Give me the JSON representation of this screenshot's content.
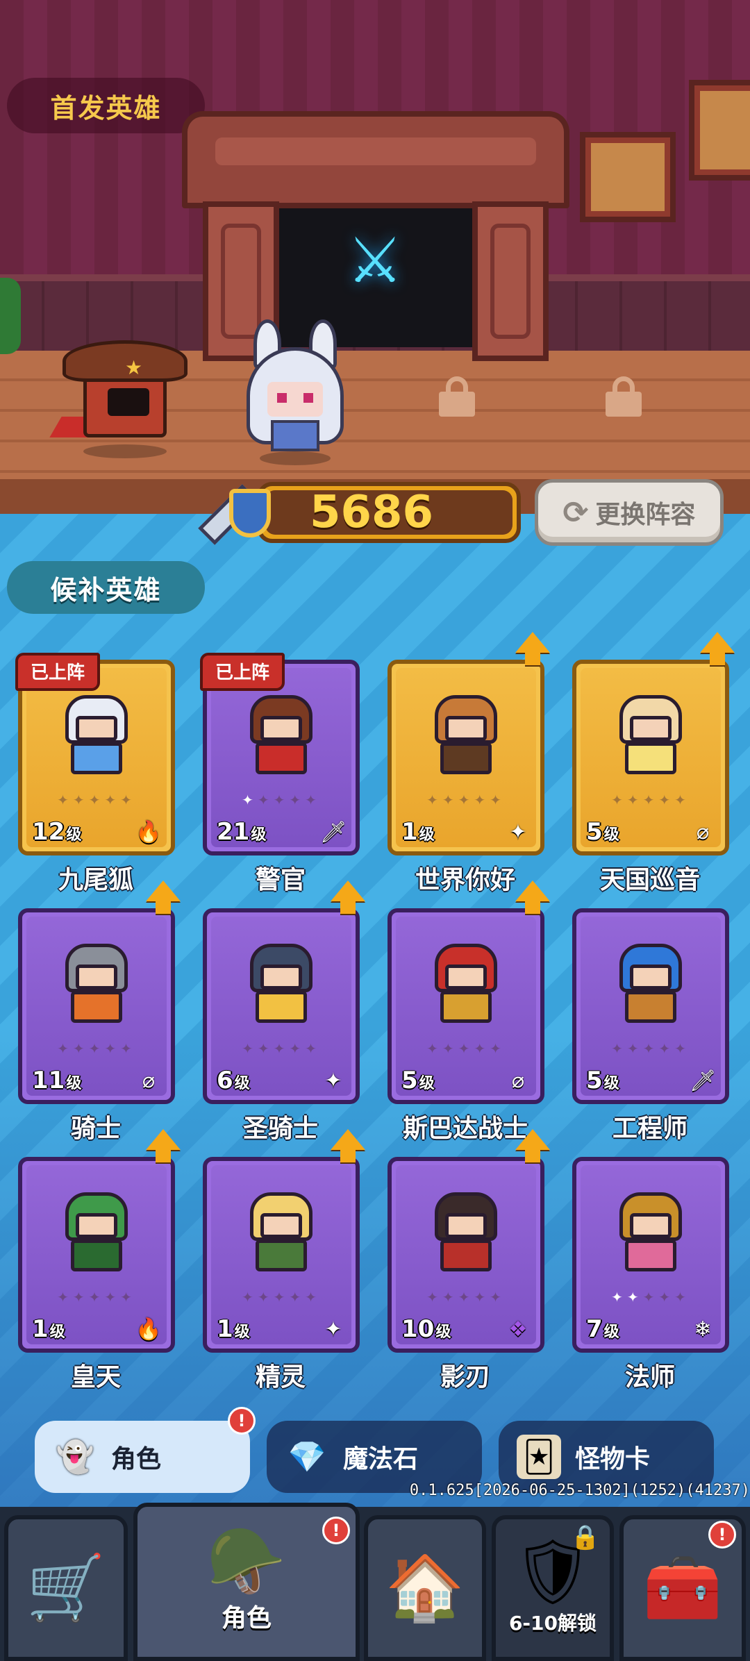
{
  "scene": {
    "starter_label": "首发英雄",
    "power_value": "5686",
    "swap_button_label": "更换阵容",
    "swap_icon": "refresh-icon",
    "battle_icon": "crossed-swords-icon",
    "locked_slots": 2
  },
  "bench": {
    "title": "候补英雄",
    "deployed_badge": "已上阵",
    "level_unit": "级",
    "heroes": [
      {
        "name": "九尾狐",
        "level": "12",
        "rarity": "gold",
        "element": "fire",
        "element_icon": "🔥",
        "deployed": true,
        "upgradable": false,
        "stars_lit": 0
      },
      {
        "name": "警官",
        "level": "21",
        "rarity": "purple",
        "element": "sword",
        "element_icon": "🗡",
        "deployed": true,
        "upgradable": false,
        "stars_lit": 1
      },
      {
        "name": "世界你好",
        "level": "1",
        "rarity": "gold",
        "element": "sparkle",
        "element_icon": "✦",
        "deployed": false,
        "upgradable": true,
        "stars_lit": 0
      },
      {
        "name": "天国巡音",
        "level": "5",
        "rarity": "gold",
        "element": "void",
        "element_icon": "⌀",
        "deployed": false,
        "upgradable": true,
        "stars_lit": 0
      },
      {
        "name": "骑士",
        "level": "11",
        "rarity": "purple",
        "element": "void",
        "element_icon": "⌀",
        "deployed": false,
        "upgradable": true,
        "stars_lit": 0
      },
      {
        "name": "圣骑士",
        "level": "6",
        "rarity": "purple",
        "element": "sparkle",
        "element_icon": "✦",
        "deployed": false,
        "upgradable": true,
        "stars_lit": 0
      },
      {
        "name": "斯巴达战士",
        "level": "5",
        "rarity": "purple",
        "element": "void",
        "element_icon": "⌀",
        "deployed": false,
        "upgradable": true,
        "stars_lit": 0
      },
      {
        "name": "工程师",
        "level": "5",
        "rarity": "purple",
        "element": "sword",
        "element_icon": "🗡",
        "deployed": false,
        "upgradable": false,
        "stars_lit": 0
      },
      {
        "name": "皇天",
        "level": "1",
        "rarity": "purple",
        "element": "fire",
        "element_icon": "🔥",
        "deployed": false,
        "upgradable": true,
        "stars_lit": 0
      },
      {
        "name": "精灵",
        "level": "1",
        "rarity": "purple",
        "element": "sparkle",
        "element_icon": "✦",
        "deployed": false,
        "upgradable": true,
        "stars_lit": 0
      },
      {
        "name": "影刃",
        "level": "10",
        "rarity": "purple",
        "element": "poison",
        "element_icon": "❖",
        "deployed": false,
        "upgradable": true,
        "stars_lit": 0
      },
      {
        "name": "法师",
        "level": "7",
        "rarity": "purple",
        "element": "frost",
        "element_icon": "❄",
        "deployed": false,
        "upgradable": false,
        "stars_lit": 2
      }
    ]
  },
  "subtabs": [
    {
      "label": "角色",
      "icon": "ghost-icon",
      "glyph": "👻",
      "active": true,
      "notify": "!"
    },
    {
      "label": "魔法石",
      "icon": "gem-icon",
      "glyph": "💎",
      "active": false
    },
    {
      "label": "怪物卡",
      "icon": "monster-card-icon",
      "glyph": "🃏",
      "active": false
    }
  ],
  "version": "0.1.625[2026-06-25-1302](1252)(41237)",
  "nav": [
    {
      "label": "",
      "icon": "shop-cart-icon",
      "glyph": "🛒"
    },
    {
      "label": "角色",
      "icon": "knight-helmet-icon",
      "glyph": "🪖",
      "active": true,
      "notify": "!"
    },
    {
      "label": "",
      "icon": "home-icon",
      "glyph": "🏠"
    },
    {
      "label": "6-10解锁",
      "icon": "guild-banner-icon",
      "glyph": "🛡",
      "locked": true
    },
    {
      "label": "",
      "icon": "treasure-chest-icon",
      "glyph": "🧰",
      "notify": "!"
    }
  ],
  "colors": {
    "gold_card": "#f5c34d",
    "purple_card": "#9a6ce0",
    "power_text": "#ffd54a",
    "deployed_badge": "#c9302a",
    "upgrade_arrow": "#f5a818"
  }
}
